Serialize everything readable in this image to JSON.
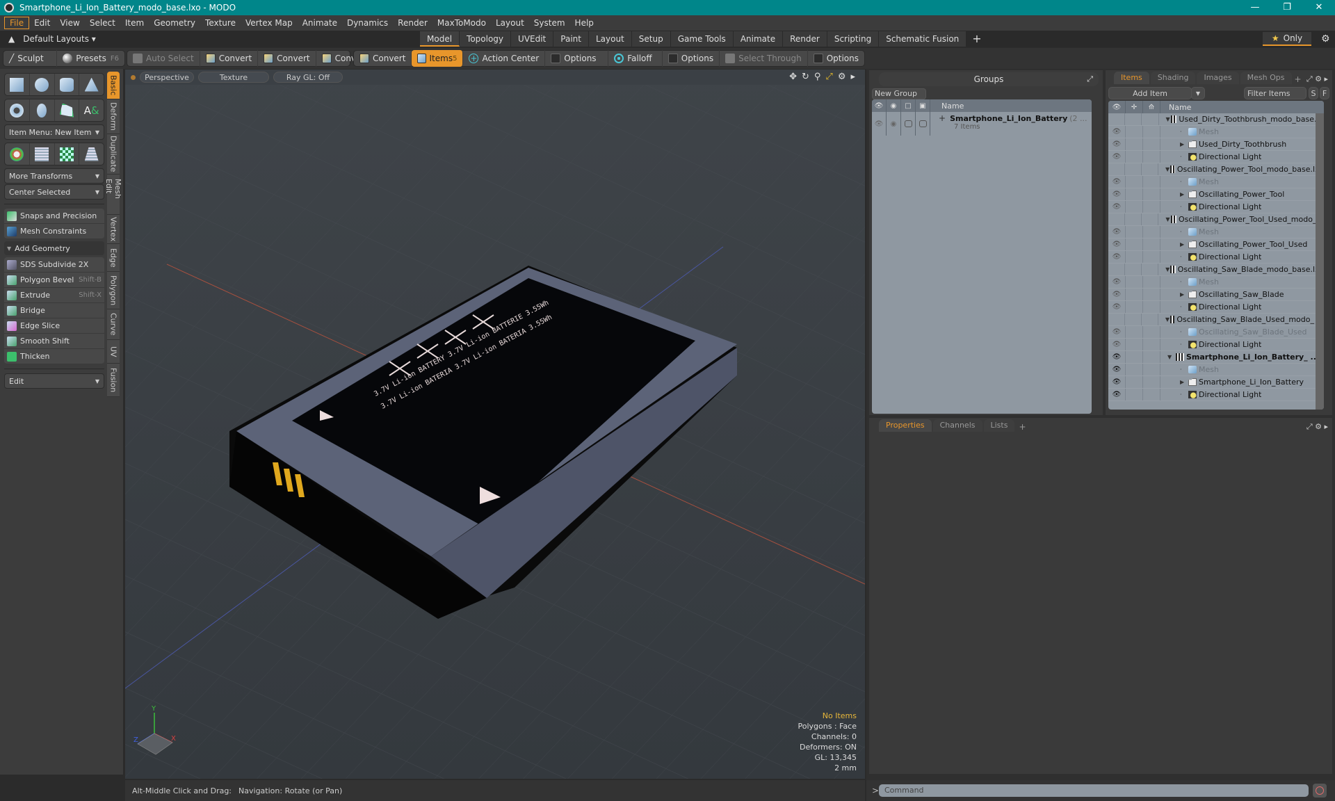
{
  "window": {
    "title": "Smartphone_Li_Ion_Battery_modo_base.lxo - MODO",
    "controls": [
      "minimize",
      "maximize",
      "close"
    ]
  },
  "menu": [
    "File",
    "Edit",
    "View",
    "Select",
    "Item",
    "Geometry",
    "Texture",
    "Vertex Map",
    "Animate",
    "Dynamics",
    "Render",
    "MaxToModo",
    "Layout",
    "System",
    "Help"
  ],
  "layout": {
    "preset": "Default Layouts",
    "tabs": [
      "Model",
      "Topology",
      "UVEdit",
      "Paint",
      "Layout",
      "Setup",
      "Game Tools",
      "Animate",
      "Render",
      "Scripting",
      "Schematic Fusion"
    ],
    "active_tab": "Model",
    "only_label": "Only"
  },
  "toolbar": {
    "sculpt": "Sculpt",
    "presets": "Presets",
    "presets_key": "F6",
    "auto_select": "Auto Select",
    "convert": [
      "Convert",
      "Convert",
      "Convert",
      "Convert"
    ],
    "items": "Items",
    "items_count": "5",
    "action_center": "Action Center",
    "options1": "Options",
    "falloff": "Falloff",
    "options2": "Options",
    "select_through": "Select Through",
    "options3": "Options"
  },
  "leftpanel": {
    "item_menu": "Item Menu: New Item",
    "more_transforms": "More Transforms",
    "center_selected": "Center Selected",
    "snaps": "Snaps and Precision",
    "mesh_constraints": "Mesh Constraints",
    "add_geometry": "Add Geometry",
    "tools": [
      {
        "label": "SDS Subdivide 2X",
        "shortcut": ""
      },
      {
        "label": "Polygon Bevel",
        "shortcut": "Shift-B"
      },
      {
        "label": "Extrude",
        "shortcut": "Shift-X"
      },
      {
        "label": "Bridge",
        "shortcut": ""
      },
      {
        "label": "Edge Slice",
        "shortcut": ""
      },
      {
        "label": "Smooth Shift",
        "shortcut": ""
      },
      {
        "label": "Thicken",
        "shortcut": ""
      }
    ],
    "edit": "Edit",
    "vtabs": [
      "Basic",
      "Deform",
      "Duplicate",
      "Mesh Edit",
      "Vertex",
      "Edge",
      "Polygon",
      "Curve",
      "UV",
      "Fusion"
    ],
    "active_vtab": "Basic"
  },
  "viewport": {
    "view": "Perspective",
    "shading": "Texture",
    "raygl": "Ray GL: Off",
    "hud": {
      "selection": "No Items",
      "polygons": "Polygons : Face",
      "channels": "Channels: 0",
      "deformers": "Deformers: ON",
      "gl": "GL: 13,345",
      "unit": "2 mm"
    },
    "axis_labels": [
      "Y",
      "X",
      "Z"
    ],
    "label_text": [
      "3.7V Li-ion BATTERY 3.7V Li-ion BATTERIE 3.55Wh",
      "3.7V Li-ion BATERIA 3.7V Li-ion BATERIA 3.55Wh"
    ],
    "accent_colors": {
      "mesh_edge": "#5c6378",
      "label": "#050505",
      "contacts": "#e0a81e"
    }
  },
  "status": {
    "hint_key": "Alt-Middle Click and Drag:",
    "hint_action": "Navigation: Rotate (or Pan)"
  },
  "groups": {
    "title": "Groups",
    "new_group": "New Group",
    "col_name": "Name",
    "entry": {
      "name": "Smartphone_Li_Ion_Battery",
      "suffix": "(2 ...",
      "count": "7 Items"
    }
  },
  "items": {
    "tabs": [
      "Items",
      "Shading",
      "Images",
      "Mesh Ops"
    ],
    "active_tab": "Items",
    "add_item": "Add Item",
    "filter": "Filter Items",
    "s_btn": "S",
    "f_btn": "F",
    "col_name": "Name",
    "rows": [
      {
        "indent": 0,
        "type": "scene",
        "label": "Used_Dirty_Toothbrush_modo_base....",
        "eye": false,
        "style": ""
      },
      {
        "indent": 1,
        "type": "mesh",
        "label": "Mesh",
        "eye": true,
        "style": "dim"
      },
      {
        "indent": 1,
        "type": "folder",
        "label": "Used_Dirty_Toothbrush",
        "eye": true,
        "style": "",
        "expand": true
      },
      {
        "indent": 1,
        "type": "light",
        "label": "Directional Light",
        "eye": true,
        "style": ""
      },
      {
        "indent": 0,
        "type": "scene",
        "label": "Oscillating_Power_Tool_modo_base.lxo",
        "eye": false,
        "style": ""
      },
      {
        "indent": 1,
        "type": "mesh",
        "label": "Mesh",
        "eye": true,
        "style": "dim"
      },
      {
        "indent": 1,
        "type": "folder",
        "label": "Oscillating_Power_Tool",
        "eye": true,
        "style": "",
        "expand": true
      },
      {
        "indent": 1,
        "type": "light",
        "label": "Directional Light",
        "eye": true,
        "style": ""
      },
      {
        "indent": 0,
        "type": "scene",
        "label": "Oscillating_Power_Tool_Used_modo_...",
        "eye": false,
        "style": ""
      },
      {
        "indent": 1,
        "type": "mesh",
        "label": "Mesh",
        "eye": true,
        "style": "dim"
      },
      {
        "indent": 1,
        "type": "folder",
        "label": "Oscillating_Power_Tool_Used",
        "eye": true,
        "style": "",
        "expand": true
      },
      {
        "indent": 1,
        "type": "light",
        "label": "Directional Light",
        "eye": true,
        "style": ""
      },
      {
        "indent": 0,
        "type": "scene",
        "label": "Oscillating_Saw_Blade_modo_base.lxo",
        "eye": false,
        "style": ""
      },
      {
        "indent": 1,
        "type": "mesh",
        "label": "Mesh",
        "eye": true,
        "style": "dim"
      },
      {
        "indent": 1,
        "type": "folder",
        "label": "Oscillating_Saw_Blade",
        "eye": true,
        "style": "",
        "expand": true
      },
      {
        "indent": 1,
        "type": "light",
        "label": "Directional Light",
        "eye": true,
        "style": ""
      },
      {
        "indent": 0,
        "type": "scene",
        "label": "Oscillating_Saw_Blade_Used_modo_ ...",
        "eye": false,
        "style": ""
      },
      {
        "indent": 1,
        "type": "mesh",
        "label": "Oscillating_Saw_Blade_Used",
        "eye": true,
        "style": "dim"
      },
      {
        "indent": 1,
        "type": "light",
        "label": "Directional Light",
        "eye": true,
        "style": ""
      },
      {
        "indent": 0,
        "type": "scene",
        "label": "Smartphone_Li_Ion_Battery_ ...",
        "eye": true,
        "style": "bold",
        "dark": true
      },
      {
        "indent": 1,
        "type": "mesh",
        "label": "Mesh",
        "eye": true,
        "style": "dim",
        "dark": true
      },
      {
        "indent": 1,
        "type": "folder",
        "label": "Smartphone_Li_Ion_Battery",
        "eye": true,
        "style": "",
        "expand": true,
        "dark": true
      },
      {
        "indent": 1,
        "type": "light",
        "label": "Directional Light",
        "eye": true,
        "style": "",
        "dark": true
      }
    ]
  },
  "properties": {
    "tabs": [
      "Properties",
      "Channels",
      "Lists"
    ],
    "active_tab": "Properties"
  },
  "command": {
    "placeholder": "Command",
    "prompt": ">"
  }
}
